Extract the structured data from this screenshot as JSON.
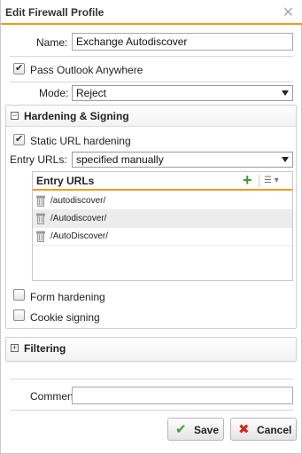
{
  "window": {
    "title": "Edit Firewall Profile",
    "close_icon": "close-icon"
  },
  "form": {
    "name_label": "Name:",
    "name_value": "Exchange Autodiscover",
    "pass_outlook_label": "Pass Outlook Anywhere",
    "pass_outlook_checked": true,
    "mode_label": "Mode:",
    "mode_value": "Reject",
    "comment_label": "Comment:",
    "comment_value": ""
  },
  "hardening": {
    "title": "Hardening & Signing",
    "toggle": "−",
    "static_url_label": "Static URL hardening",
    "static_url_checked": true,
    "entry_urls_label": "Entry URLs:",
    "entry_urls_value": "specified manually",
    "grid": {
      "title": "Entry URLs",
      "add_icon": "+",
      "menu_icon": "☰ ▾",
      "rows": [
        "/autodiscover/",
        "/Autodiscover/",
        "/AutoDiscover/"
      ]
    },
    "form_hardening_label": "Form hardening",
    "cookie_signing_label": "Cookie signing"
  },
  "filtering": {
    "title": "Filtering",
    "toggle": "+"
  },
  "buttons": {
    "save_label": "Save",
    "save_icon": "✔",
    "cancel_label": "Cancel",
    "cancel_icon": "✖"
  },
  "colors": {
    "accent": "#f39a1e",
    "add_green": "#3a9a2e",
    "cancel_red": "#d0281e"
  }
}
